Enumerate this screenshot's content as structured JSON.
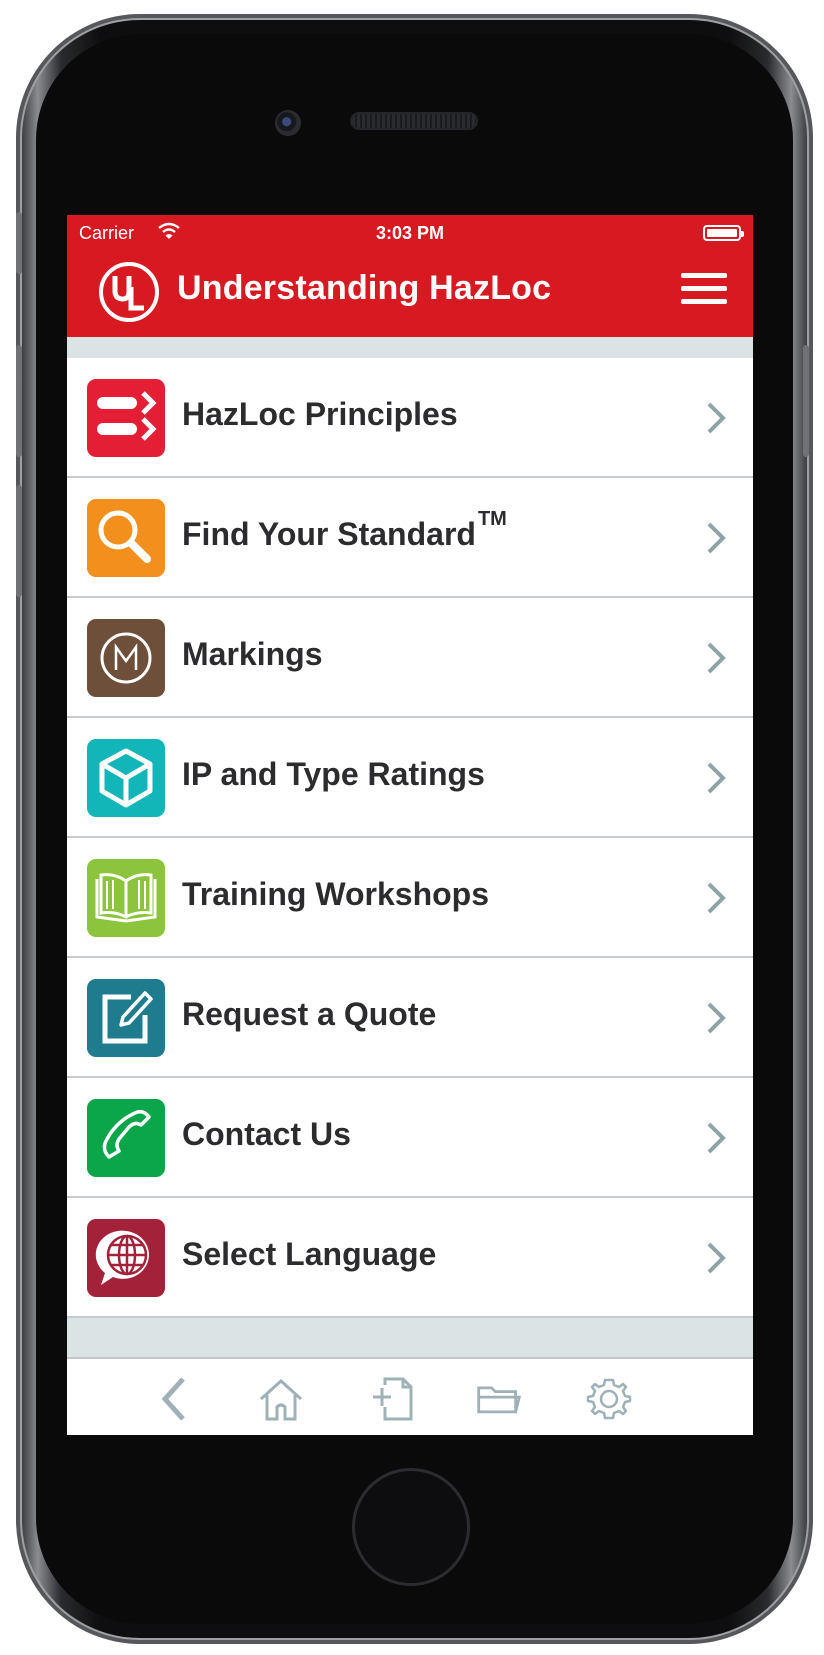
{
  "status_bar": {
    "carrier": "Carrier",
    "time": "3:03 PM"
  },
  "header": {
    "title": "Understanding HazLoc",
    "logo": "ul-logo",
    "menu_icon": "hamburger-menu-icon"
  },
  "menu": {
    "items": [
      {
        "label": "HazLoc Principles",
        "sup": "",
        "icon": "principles-icon",
        "color": "#e41f35"
      },
      {
        "label": "Find Your Standard",
        "sup": "TM",
        "icon": "magnifier-icon",
        "color": "#f3901d"
      },
      {
        "label": "Markings",
        "sup": "",
        "icon": "marking-m-icon",
        "color": "#6e4f3a"
      },
      {
        "label": "IP and Type Ratings",
        "sup": "",
        "icon": "cube-icon",
        "color": "#12b5b8"
      },
      {
        "label": "Training Workshops",
        "sup": "",
        "icon": "book-icon",
        "color": "#8cc43e"
      },
      {
        "label": "Request a Quote",
        "sup": "",
        "icon": "edit-icon",
        "color": "#1f7c8f"
      },
      {
        "label": "Contact Us",
        "sup": "",
        "icon": "phone-icon",
        "color": "#0ca64a"
      },
      {
        "label": "Select Language",
        "sup": "",
        "icon": "globe-chat-icon",
        "color": "#a3223a"
      }
    ]
  },
  "toolbar": {
    "buttons": [
      "back-icon",
      "home-icon",
      "new-document-icon",
      "folder-icon",
      "settings-gear-icon"
    ]
  },
  "colors": {
    "brand_red": "#d71a21",
    "background": "#dce3e4",
    "chevron": "#8ea3a8",
    "toolbar_icons": "#9fb1b6"
  }
}
